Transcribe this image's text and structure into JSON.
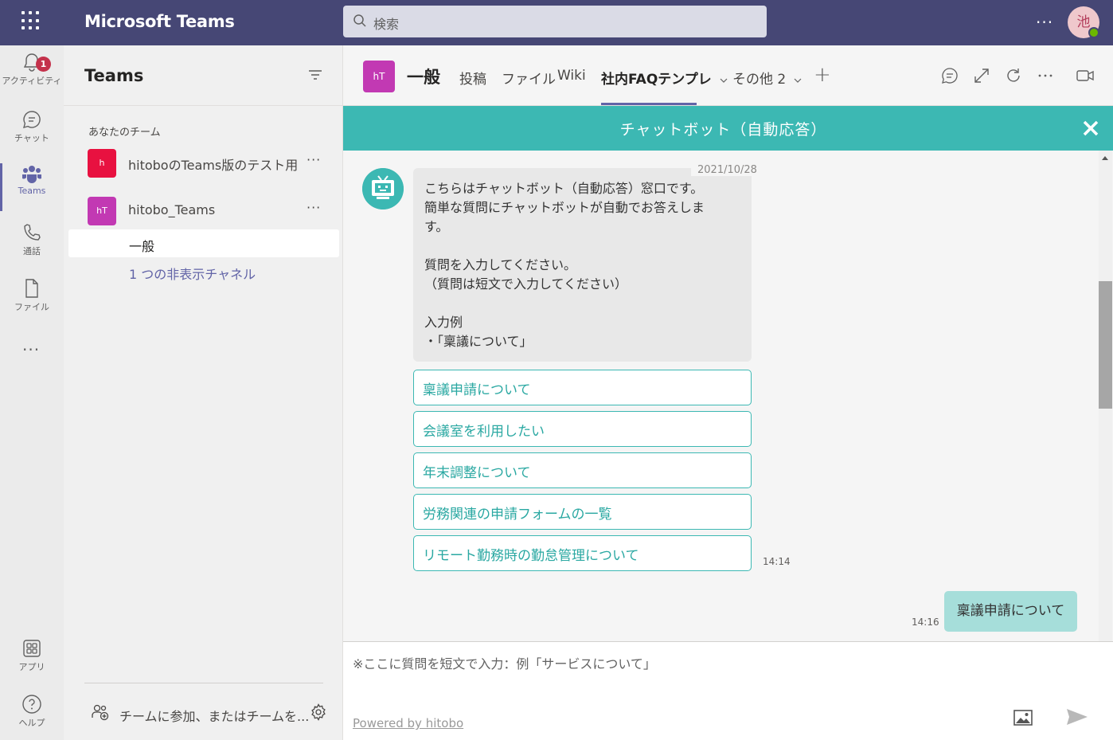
{
  "topbar": {
    "app_title": "Microsoft Teams",
    "search_placeholder": "検索",
    "more": "···",
    "avatar_initial": "池",
    "bg_color": "#464775"
  },
  "rail": {
    "items": [
      {
        "label": "アクティビティ",
        "icon": "bell-icon",
        "badge": "1"
      },
      {
        "label": "チャット",
        "icon": "chat-icon"
      },
      {
        "label": "Teams",
        "icon": "teams-icon",
        "active": true
      },
      {
        "label": "通話",
        "icon": "phone-icon"
      },
      {
        "label": "ファイル",
        "icon": "file-icon"
      },
      {
        "label": "アプリ",
        "icon": "apps-icon"
      },
      {
        "label": "ヘルプ",
        "icon": "help-icon"
      }
    ],
    "more": "···"
  },
  "teams_panel": {
    "title": "Teams",
    "section_label": "あなたのチーム",
    "teams": [
      {
        "initials": "h",
        "name": "hitoboのTeams版のテスト用",
        "color": "#e81140",
        "more": "···"
      },
      {
        "initials": "hT",
        "name": "hitobo_Teams",
        "color": "#c239b3",
        "more": "···"
      }
    ],
    "channel": "一般",
    "hidden_channels": "1 つの非表示チャネル",
    "join_label": "チームに参加、またはチームを..."
  },
  "channel_header": {
    "avatar_initials": "hT",
    "title": "一般",
    "tabs": [
      "投稿",
      "ファイル",
      "Wiki",
      "社内FAQテンプレ",
      "その他 2"
    ],
    "active_tab": "社内FAQテンプレ",
    "add_tab": "+",
    "accent": "#6264a7"
  },
  "chatbot": {
    "header_title": "チャットボット（自動応答）",
    "header_color": "#3cb8b3",
    "date": "2021/10/28",
    "bot_message": "こちらはチャットボット（自動応答）窓口です。\n簡単な質問にチャットボットが自動でお答えしま\nす。\n\n質問を入力してください。\n（質問は短文で入力してください）\n\n入力例\n・「稟議について」",
    "options": [
      "稟議申請について",
      "会議室を利用したい",
      "年末調整について",
      "労務関連の申請フォームの一覧",
      "リモート勤務時の勤怠管理について"
    ],
    "bot_time": "14:14",
    "user_message": "稟議申請について",
    "user_time": "14:16",
    "input_placeholder": "※ここに質問を短文で入力：例「サービスについて」",
    "powered_by": "Powered by hitobo"
  }
}
